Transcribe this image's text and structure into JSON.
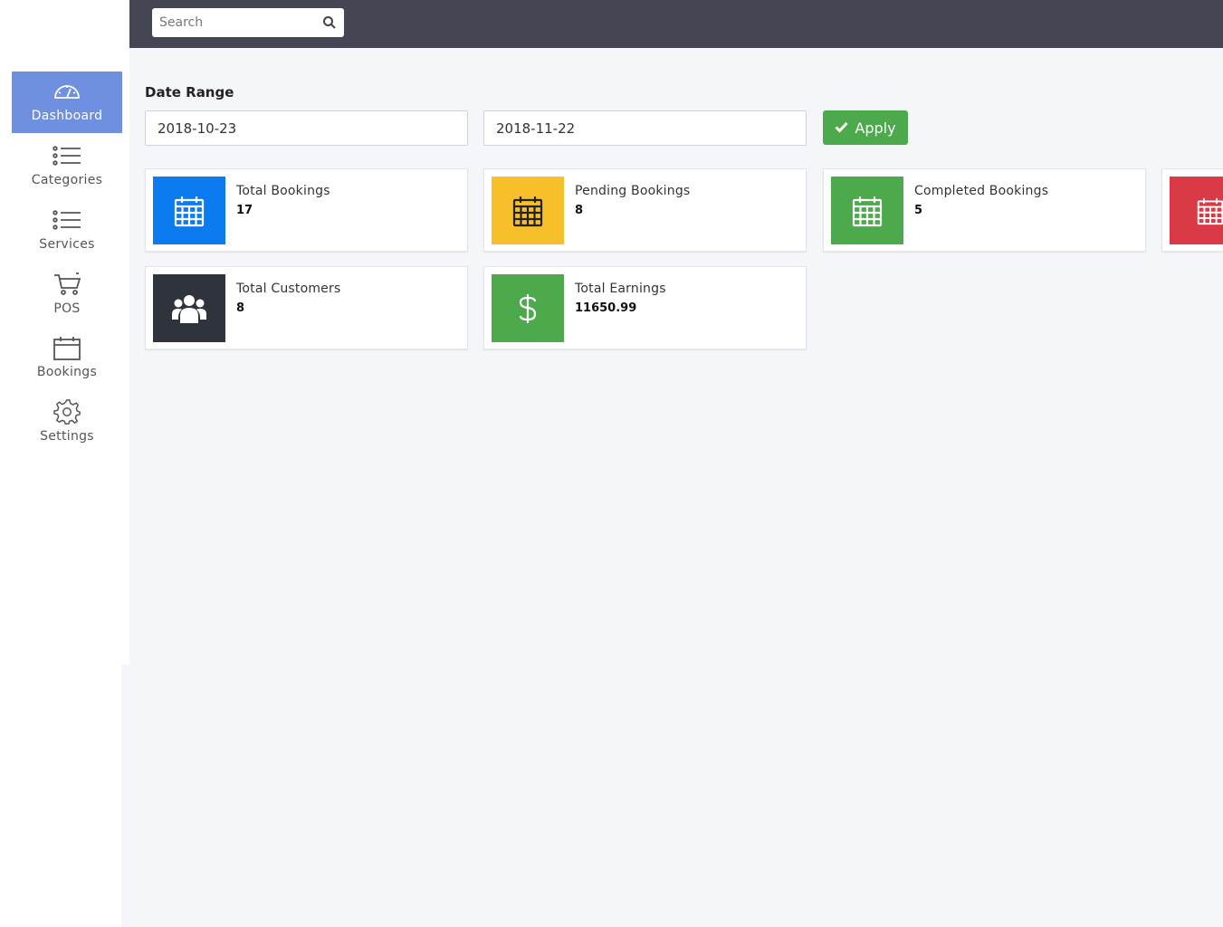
{
  "sidebar": {
    "items": [
      {
        "label": "Dashboard",
        "icon": "dashboard-icon",
        "active": true
      },
      {
        "label": "Categories",
        "icon": "list-icon"
      },
      {
        "label": "Services",
        "icon": "list-icon"
      },
      {
        "label": "POS",
        "icon": "cart-icon"
      },
      {
        "label": "Bookings",
        "icon": "calendar-icon"
      },
      {
        "label": "Settings",
        "icon": "gear-icon"
      }
    ]
  },
  "topbar": {
    "search_placeholder": "Search"
  },
  "date_range": {
    "label": "Date Range",
    "start": "2018-10-23",
    "end": "2018-11-22",
    "apply_label": "Apply"
  },
  "cards": [
    {
      "title": "Total Bookings",
      "value": "17",
      "color": "#0d7bf0",
      "icon": "calendar-icon"
    },
    {
      "title": "Pending Bookings",
      "value": "8",
      "color": "#f7c02b",
      "icon": "calendar-icon"
    },
    {
      "title": "Completed Bookings",
      "value": "5",
      "color": "#4caa4c",
      "icon": "calendar-icon"
    },
    {
      "title": "",
      "value": "",
      "color": "#d93a45",
      "icon": "calendar-icon"
    },
    {
      "title": "Total Customers",
      "value": "8",
      "color": "#2f333c",
      "icon": "users-icon"
    },
    {
      "title": "Total Earnings",
      "value": "11650.99",
      "color": "#4caa4c",
      "icon": "dollar-icon"
    }
  ],
  "colors": {
    "topbar": "#444654",
    "active_nav": "#6f8fe0",
    "apply": "#4caa4c"
  }
}
